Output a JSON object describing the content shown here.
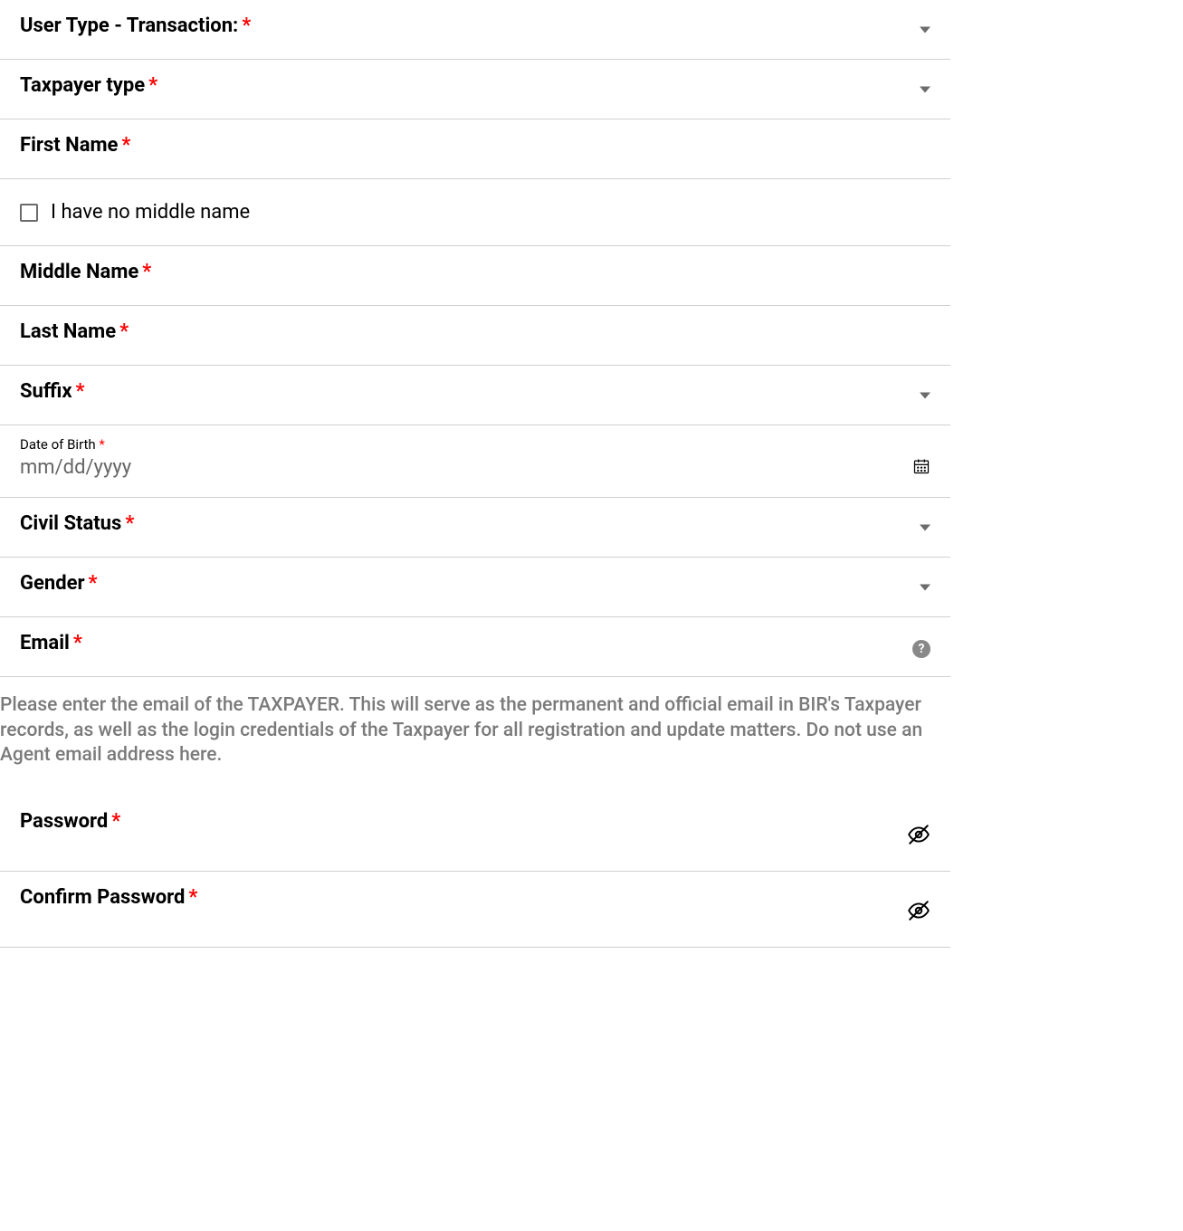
{
  "fields": {
    "user_type": {
      "label": "User Type - Transaction:"
    },
    "taxpayer_type": {
      "label": "Taxpayer type"
    },
    "first_name": {
      "label": "First Name"
    },
    "no_middle": {
      "label": "I have no middle name"
    },
    "middle_name": {
      "label": "Middle Name"
    },
    "last_name": {
      "label": "Last Name"
    },
    "suffix": {
      "label": "Suffix"
    },
    "dob": {
      "label": "Date of Birth",
      "placeholder": "mm/dd/yyyy"
    },
    "civil_status": {
      "label": "Civil Status"
    },
    "gender": {
      "label": "Gender"
    },
    "email": {
      "label": "Email"
    },
    "password": {
      "label": "Password"
    },
    "confirm_password": {
      "label": "Confirm Password"
    }
  },
  "help": {
    "email": "Please enter the email of the TAXPAYER. This will serve as the permanent and official email in BIR's Taxpayer records, as well as the login credentials of the Taxpayer for all registration and update matters. Do not use an Agent email address here."
  }
}
